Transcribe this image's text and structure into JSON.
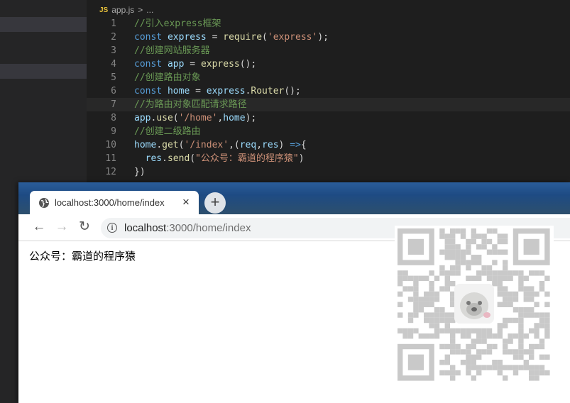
{
  "editor": {
    "breadcrumb": {
      "badge": "JS",
      "file": "app.js",
      "sep": ">",
      "rest": "..."
    },
    "lines": [
      {
        "n": "1",
        "tokens": [
          [
            "cm",
            "//引入express框架"
          ]
        ]
      },
      {
        "n": "2",
        "tokens": [
          [
            "kw",
            "const "
          ],
          [
            "var",
            "express"
          ],
          [
            "pl",
            " = "
          ],
          [
            "fn",
            "require"
          ],
          [
            "pl",
            "("
          ],
          [
            "str",
            "'express'"
          ],
          [
            "pl",
            ");"
          ]
        ]
      },
      {
        "n": "3",
        "tokens": [
          [
            "cm",
            "//创建网站服务器"
          ]
        ]
      },
      {
        "n": "4",
        "tokens": [
          [
            "kw",
            "const "
          ],
          [
            "var",
            "app"
          ],
          [
            "pl",
            " = "
          ],
          [
            "fn",
            "express"
          ],
          [
            "pl",
            "();"
          ]
        ]
      },
      {
        "n": "5",
        "tokens": [
          [
            "cm",
            "//创建路由对象"
          ]
        ]
      },
      {
        "n": "6",
        "tokens": [
          [
            "kw",
            "const "
          ],
          [
            "var",
            "home"
          ],
          [
            "pl",
            " = "
          ],
          [
            "var",
            "express"
          ],
          [
            "pl",
            "."
          ],
          [
            "fn",
            "Router"
          ],
          [
            "pl",
            "();"
          ]
        ]
      },
      {
        "n": "7",
        "tokens": [
          [
            "cm",
            "//为路由对象匹配请求路径"
          ]
        ]
      },
      {
        "n": "8",
        "tokens": [
          [
            "var",
            "app"
          ],
          [
            "pl",
            "."
          ],
          [
            "fn",
            "use"
          ],
          [
            "pl",
            "("
          ],
          [
            "str",
            "'/home'"
          ],
          [
            "pl",
            ","
          ],
          [
            "var",
            "home"
          ],
          [
            "pl",
            ");"
          ]
        ]
      },
      {
        "n": "9",
        "tokens": [
          [
            "cm",
            "//创建二级路由"
          ]
        ]
      },
      {
        "n": "10",
        "tokens": [
          [
            "var",
            "home"
          ],
          [
            "pl",
            "."
          ],
          [
            "fn",
            "get"
          ],
          [
            "pl",
            "("
          ],
          [
            "str",
            "'/index'"
          ],
          [
            "pl",
            ",("
          ],
          [
            "var",
            "req"
          ],
          [
            "pl",
            ","
          ],
          [
            "var",
            "res"
          ],
          [
            "pl",
            ") "
          ],
          [
            "kw",
            "=>"
          ],
          [
            "pl",
            "{"
          ]
        ]
      },
      {
        "n": "11",
        "tokens": [
          [
            "pl",
            "  "
          ],
          [
            "var",
            "res"
          ],
          [
            "pl",
            "."
          ],
          [
            "fn",
            "send"
          ],
          [
            "pl",
            "("
          ],
          [
            "str",
            "\"公众号：霸道的程序猿\""
          ],
          [
            "pl",
            ")"
          ]
        ]
      },
      {
        "n": "12",
        "tokens": [
          [
            "pl",
            "})"
          ]
        ]
      }
    ]
  },
  "browser": {
    "tab_title": "localhost:3000/home/index",
    "tab_close": "×",
    "new_tab": "+",
    "back": "←",
    "forward": "→",
    "reload": "↻",
    "info_icon": "i",
    "url_host": "localhost",
    "url_rest": ":3000/home/index",
    "page_text": "公众号：霸道的程序猿"
  },
  "colors": {
    "editor_bg": "#1e1e1e",
    "sidebar_bg": "#252526",
    "keyword": "#569cd6",
    "variable": "#9cdcfe",
    "function": "#dcdcaa",
    "string": "#ce9178",
    "comment": "#6a9955",
    "tabstrip": "#1e4b83",
    "qr_module": "#c9c9c9"
  }
}
